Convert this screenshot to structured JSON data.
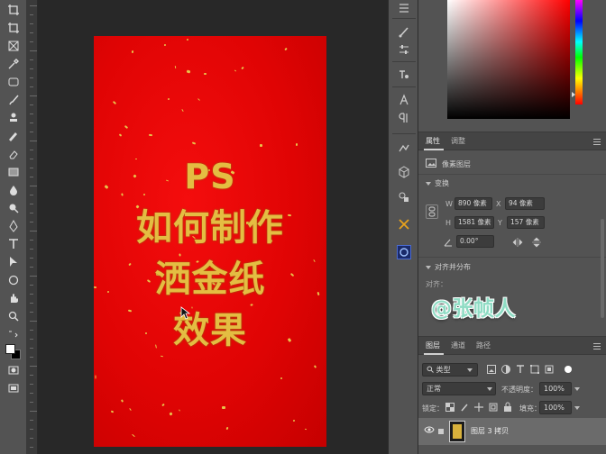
{
  "document": {
    "title_lines": [
      "PS",
      "如何制作",
      "洒金纸",
      "效果"
    ],
    "background_colors": [
      "#f40d0d",
      "#c50000"
    ],
    "text_color": "#e4bd42"
  },
  "watermark": "@张帧人",
  "properties_panel": {
    "tabs": [
      "属性",
      "调整"
    ],
    "layer_type": "像素图层",
    "transform_label": "变换",
    "width_label": "W",
    "width_value": "890 像素",
    "x_label": "X",
    "x_value": "94 像素",
    "height_label": "H",
    "height_value": "1581 像素",
    "y_label": "Y",
    "y_value": "157 像素",
    "angle_value": "0.00°",
    "align_label": "对齐并分布",
    "align_sub": "对齐："
  },
  "layers_panel": {
    "tabs": [
      "图层",
      "通道",
      "路径"
    ],
    "filter_type": "类型",
    "blend_mode": "正常",
    "opacity_label": "不透明度：",
    "opacity_value": "100%",
    "lock_label": "锁定：",
    "fill_label": "填充：",
    "fill_value": "100%",
    "layer_name": "图层 3 拷贝"
  },
  "colors": {
    "accent_foreground": "#ffffff",
    "accent_background": "#000000"
  }
}
